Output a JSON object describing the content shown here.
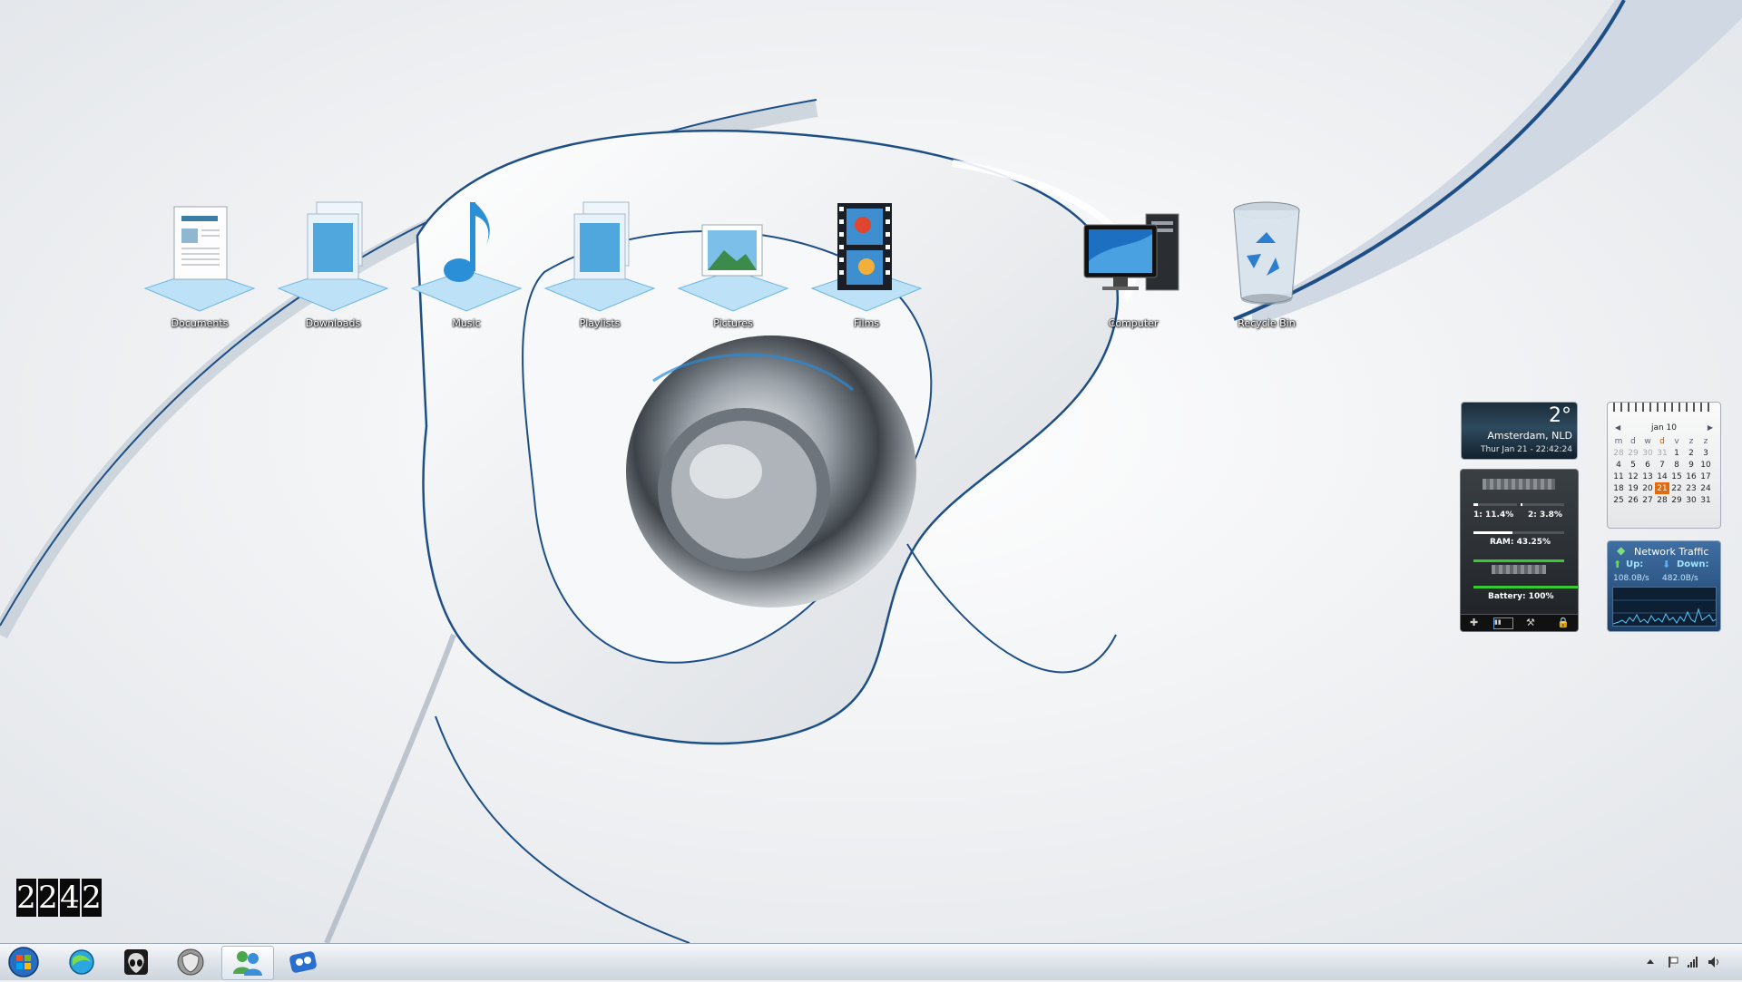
{
  "theme": {
    "accent": "#1d4f86",
    "taskbar_bg": "#dfe4ea",
    "calendar_today": "#e46a10",
    "network_bg": "#2d5688",
    "sysmon_bar_green": "#39c935"
  },
  "desktop": {
    "icons": [
      {
        "label": "Documents",
        "icon": "documents-library-icon"
      },
      {
        "label": "Downloads",
        "icon": "downloads-folder-icon"
      },
      {
        "label": "Music",
        "icon": "music-note-icon"
      },
      {
        "label": "Playlists",
        "icon": "playlists-folder-icon"
      },
      {
        "label": "Pictures",
        "icon": "pictures-icon"
      },
      {
        "label": "Films",
        "icon": "film-strip-icon"
      },
      {
        "label": "Computer",
        "icon": "computer-icon"
      },
      {
        "label": "Recycle Bin",
        "icon": "recycle-bin-icon"
      }
    ]
  },
  "gadgets": {
    "weather": {
      "temperature": "2°",
      "location": "Amsterdam, NLD",
      "datetime": "Thur Jan 21 - 22:42:24"
    },
    "system_monitor": {
      "cpu1": "1: 11.4%",
      "cpu2": "2: 3.8%",
      "cpu1_fraction": 0.114,
      "cpu2_fraction": 0.038,
      "ram": "RAM: 43.25%",
      "ram_fraction": 0.4325,
      "battery": "Battery: 100%",
      "battery_fraction": 1.0
    },
    "calendar": {
      "month": "jan 10",
      "weekdays": [
        "m",
        "d",
        "w",
        "d",
        "v",
        "z",
        "z"
      ],
      "weeks": [
        [
          "28",
          "29",
          "30",
          "31",
          "1",
          "2",
          "3"
        ],
        [
          "4",
          "5",
          "6",
          "7",
          "8",
          "9",
          "10"
        ],
        [
          "11",
          "12",
          "13",
          "14",
          "15",
          "16",
          "17"
        ],
        [
          "18",
          "19",
          "20",
          "21",
          "22",
          "23",
          "24"
        ],
        [
          "25",
          "26",
          "27",
          "28",
          "29",
          "30",
          "31"
        ]
      ],
      "today": "21"
    },
    "network": {
      "title": "Network Traffic",
      "up_label": "Up:",
      "down_label": "Down:",
      "up_rate": "108.0B/s",
      "down_rate": "482.0B/s"
    }
  },
  "clock_widget": {
    "digits": [
      "2",
      "2",
      "4",
      "2"
    ]
  },
  "taskbar": {
    "items": [
      {
        "name": "start-button",
        "icon": "windows-orb-icon"
      },
      {
        "name": "taskbar-app-browser",
        "icon": "globe-icon"
      },
      {
        "name": "taskbar-app-alien",
        "icon": "alien-icon"
      },
      {
        "name": "taskbar-app-shield",
        "icon": "shield-icon"
      },
      {
        "name": "taskbar-app-messenger",
        "icon": "messenger-icon",
        "active": true
      },
      {
        "name": "taskbar-app-media",
        "icon": "media-icon"
      }
    ],
    "tray_icons": [
      "show-hidden-icon",
      "flag-icon",
      "network-signal-icon",
      "volume-icon"
    ]
  }
}
